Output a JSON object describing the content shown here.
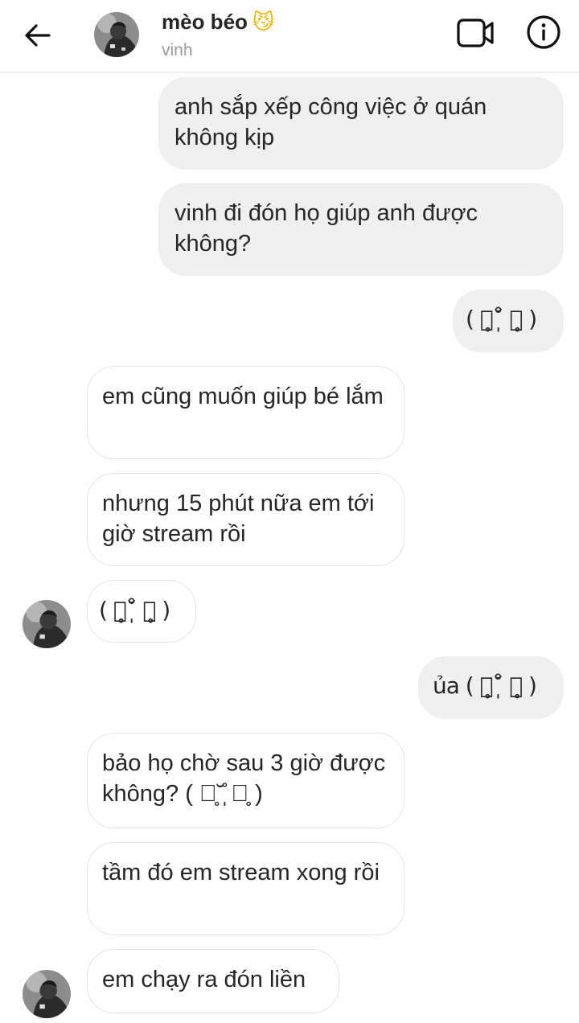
{
  "header": {
    "title": "mèo béo",
    "title_emoji": "😼",
    "subtitle": "vinh"
  },
  "messages": [
    {
      "from": "me",
      "text": "anh sắp xếp công việc ở quán không kịp"
    },
    {
      "from": "me",
      "text": "vinh đi đón họ giúp anh được không?"
    },
    {
      "from": "me",
      "text": "( ꈨ̥˘̩̊ ꈨ̥ )"
    },
    {
      "from": "them",
      "text": "em cũng muốn giúp bé lắm"
    },
    {
      "from": "them",
      "text": "nhưng 15 phút nữa em tới giờ stream rồi"
    },
    {
      "from": "them",
      "text": "( ꈨ̥˘̩̊ ꈨ̥ )"
    },
    {
      "from": "me",
      "text": "ủa ( ꈨ̥˘̩̊ ꈨ̥ )"
    },
    {
      "from": "them",
      "text": "bảo họ chờ sau 3 giờ được không? ( ꈨ̥˘̩̊ ꈨ̥ )"
    },
    {
      "from": "them",
      "text": "tầm đó em stream xong rồi"
    },
    {
      "from": "them",
      "text": "em chạy ra đón liền"
    }
  ],
  "colors": {
    "outgoing_bubble": "#efefef",
    "incoming_border": "#e3e3e3",
    "text": "#262626",
    "subtitle": "#9a9a9a"
  },
  "icons": [
    "back-arrow-icon",
    "video-call-icon",
    "info-icon",
    "avatar"
  ]
}
